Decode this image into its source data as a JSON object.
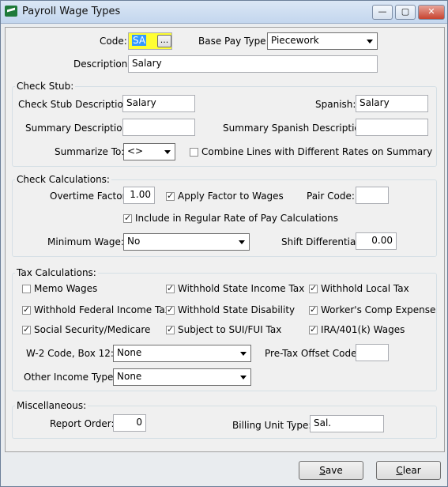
{
  "window": {
    "title": "Payroll Wage Types",
    "min": "—",
    "max": "▢",
    "close": "✕"
  },
  "header": {
    "code_label": "Code:",
    "code_value": "SA",
    "ellipsis": "...",
    "base_pay_label": "Base Pay Type:",
    "base_pay_value": "Piecework",
    "description_label": "Description:",
    "description_value": "Salary"
  },
  "check_stub": {
    "title": "Check Stub:",
    "desc_label": "Check Stub Description:",
    "desc_value": "Salary",
    "spanish_label": "Spanish:",
    "spanish_value": "Salary",
    "summary_label": "Summary Description:",
    "summary_value": "",
    "summary_spanish_label": "Summary Spanish Description:",
    "summary_spanish_value": "",
    "summarize_label": "Summarize To:",
    "summarize_value": "<>",
    "combine_label": "Combine Lines with Different Rates on Summary",
    "combine_checked": false
  },
  "check_calc": {
    "title": "Check Calculations:",
    "overtime_label": "Overtime Factor:",
    "overtime_value": "1.00",
    "apply_factor_label": "Apply Factor to Wages",
    "apply_factor_checked": true,
    "pair_code_label": "Pair Code:",
    "pair_code_value": "",
    "include_regular_label": "Include in Regular Rate of Pay Calculations",
    "include_regular_checked": true,
    "min_wage_label": "Minimum Wage:",
    "min_wage_value": "No",
    "shift_diff_label": "Shift Differential:",
    "shift_diff_value": "0.00"
  },
  "tax_calc": {
    "title": "Tax Calculations:",
    "memo_wages": "Memo Wages",
    "withhold_state_income": "Withhold State Income Tax",
    "withhold_local": "Withhold Local Tax",
    "withhold_federal": "Withhold Federal Income Tax",
    "withhold_state_disability": "Withhold State Disability",
    "workers_comp": "Worker's Comp Expense",
    "social_security": "Social Security/Medicare",
    "subject_sui": "Subject to SUI/FUI Tax",
    "ira": "IRA/401(k) Wages",
    "w2_label": "W-2 Code, Box 12:",
    "w2_value": "None",
    "pretax_label": "Pre-Tax Offset Code:",
    "pretax_value": "",
    "other_income_label": "Other Income Type:",
    "other_income_value": "None"
  },
  "misc": {
    "title": "Miscellaneous:",
    "report_order_label": "Report Order:",
    "report_order_value": "0",
    "billing_unit_label": "Billing Unit Type:",
    "billing_unit_value": "Sal."
  },
  "footer": {
    "save_label": "ave",
    "save_mnemonic": "S",
    "clear_label": "lear",
    "clear_mnemonic": "C"
  }
}
